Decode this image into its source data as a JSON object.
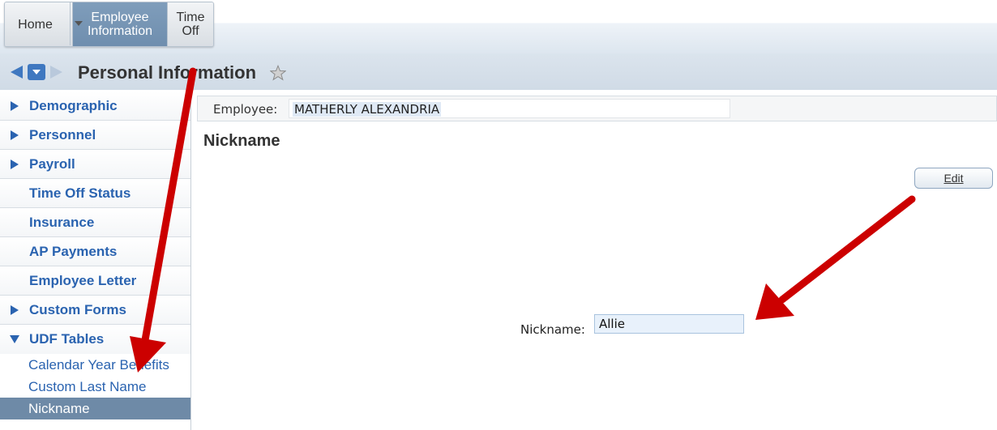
{
  "nav": {
    "home_label": "Home",
    "tabs": [
      {
        "label_line1": "Employee",
        "label_line2": "Information"
      },
      {
        "label_line1": "Time",
        "label_line2": "Off"
      }
    ]
  },
  "header": {
    "title": "Personal Information"
  },
  "sidebar": {
    "items": [
      {
        "label": "Demographic",
        "expandable": true
      },
      {
        "label": "Personnel",
        "expandable": true
      },
      {
        "label": "Payroll",
        "expandable": true
      },
      {
        "label": "Time Off Status",
        "expandable": false
      },
      {
        "label": "Insurance",
        "expandable": false
      },
      {
        "label": "AP Payments",
        "expandable": false
      },
      {
        "label": "Employee Letter",
        "expandable": false
      },
      {
        "label": "Custom Forms",
        "expandable": true
      },
      {
        "label": "UDF Tables",
        "expandable": true,
        "expanded": true
      }
    ],
    "subitems": [
      {
        "label": "Calendar Year Benefits"
      },
      {
        "label": "Custom Last Name"
      },
      {
        "label": "Nickname",
        "active": true
      }
    ]
  },
  "main": {
    "employee_label": "Employee:",
    "employee_value": "MATHERLY ALEXANDRIA",
    "section_title": "Nickname",
    "edit_label": "Edit",
    "nickname_label": "Nickname:",
    "nickname_value": "Allie"
  },
  "colors": {
    "link_blue": "#2a63b0",
    "active_tab": "#6f8eae",
    "annotation_arrow": "#cc0000"
  },
  "icons": [
    "left-arrow-icon",
    "dropdown-icon",
    "right-arrow-icon",
    "star-icon",
    "triangle-right-icon",
    "triangle-down-icon"
  ]
}
